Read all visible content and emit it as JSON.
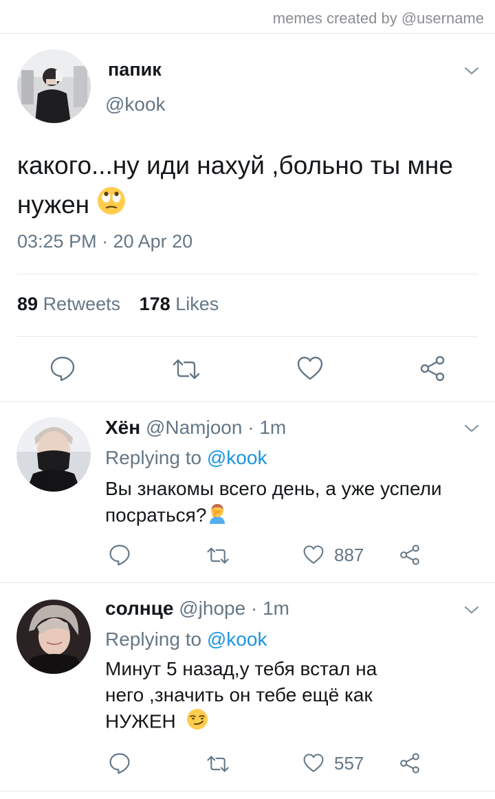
{
  "credit": "memes created by @username",
  "main_tweet": {
    "name": "папик",
    "handle": "@kook",
    "text": "какого...ну иди нахуй ,больно ты мне нужен",
    "emoji": "face-with-rolling-eyes",
    "timestamp": "03:25 PM · 20 Apr 20",
    "retweets_count": "89",
    "retweets_label": "Retweets",
    "likes_count": "178",
    "likes_label": "Likes"
  },
  "replies": [
    {
      "name": "Хён",
      "handle": "@Namjoon · 1m",
      "replying_prefix": "Replying to",
      "replying_mention": "@kook",
      "text": "Вы знакомы всего день, а уже успели посраться?",
      "emoji": "person-facepalming",
      "likes": "887"
    },
    {
      "name": "солнце",
      "handle": "@jhope · 1m",
      "replying_prefix": "Replying to",
      "replying_mention": "@kook",
      "text_line1": "Минут 5 назад,у тебя встал на",
      "text_line2": "него ,значить он тебе ещё как",
      "text_line3": "НУЖЕН",
      "emoji": "smirking-face",
      "likes": "557"
    }
  ],
  "colors": {
    "text": "#14171a",
    "secondary": "#657786",
    "accent": "#1b95e0",
    "border": "#e1e8ed",
    "icon": "#657786"
  }
}
